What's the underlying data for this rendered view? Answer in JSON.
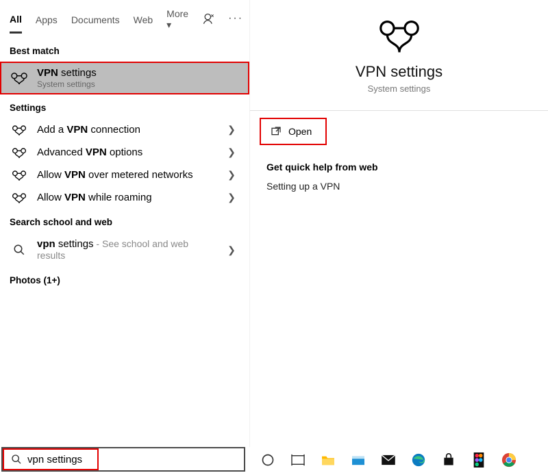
{
  "tabs": {
    "all": "All",
    "apps": "Apps",
    "documents": "Documents",
    "web": "Web",
    "more": "More"
  },
  "sections": {
    "best_match": "Best match",
    "settings": "Settings",
    "school_web": "Search school and web",
    "photos": "Photos (1+)"
  },
  "best_match": {
    "title_pre": "VPN",
    "title_post": " settings",
    "sub": "System settings"
  },
  "settings_list": [
    {
      "pre": "Add a ",
      "bold": "VPN",
      "post": " connection"
    },
    {
      "pre": "Advanced ",
      "bold": "VPN",
      "post": " options"
    },
    {
      "pre": "Allow ",
      "bold": "VPN",
      "post": " over metered networks"
    },
    {
      "pre": "Allow ",
      "bold": "VPN",
      "post": " while roaming"
    }
  ],
  "web_result": {
    "bold": "vpn",
    "post": " settings",
    "hint": " - See school and web results"
  },
  "preview": {
    "title": "VPN settings",
    "sub": "System settings",
    "open": "Open"
  },
  "help": {
    "title": "Get quick help from web",
    "item": "Setting up a VPN"
  },
  "search": {
    "value": "vpn settings"
  }
}
